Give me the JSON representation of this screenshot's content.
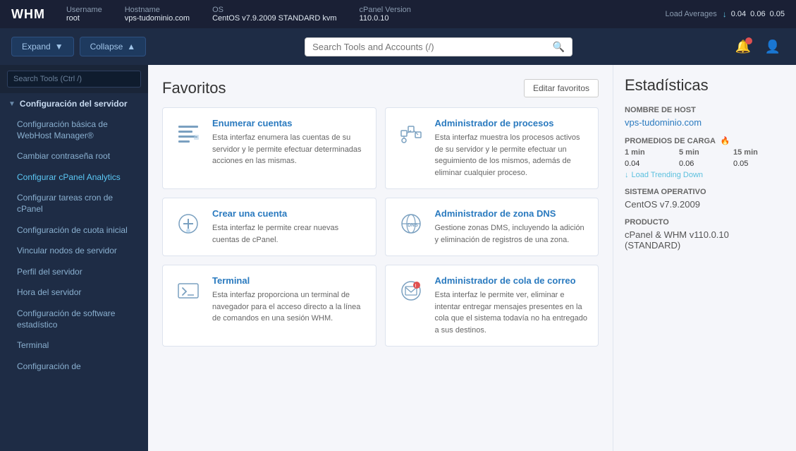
{
  "topbar": {
    "logo": "WHM",
    "username_label": "Username",
    "username": "root",
    "hostname_label": "Hostname",
    "hostname": "vps-tudominio.com",
    "os_label": "OS",
    "os": "CentOS v7.9.2009 STANDARD kvm",
    "cpanel_label": "cPanel Version",
    "cpanel": "110.0.10",
    "load_label": "Load Averages",
    "load_down": "↓",
    "load_1min_label": "0.04",
    "load_5min_label": "0.06",
    "load_15min_label": "0.05"
  },
  "toolbar": {
    "expand_label": "Expand",
    "collapse_label": "Collapse",
    "search_placeholder": "Search Tools and Accounts (/)"
  },
  "sidebar": {
    "search_placeholder": "Search Tools (Ctrl /)",
    "section": "Configuración del servidor",
    "items": [
      "Configuración básica de WebHost Manager®",
      "Cambiar contraseña root",
      "Configurar cPanel Analytics",
      "Configurar tareas cron de cPanel",
      "Configuración de cuota inicial",
      "Vincular nodos de servidor",
      "Perfil del servidor",
      "Hora del servidor",
      "Configuración de software estadístico",
      "Terminal",
      "Configuración de"
    ]
  },
  "favoritos": {
    "title": "Favoritos",
    "edit_btn": "Editar favoritos",
    "cards": [
      {
        "id": "enumerar",
        "title": "Enumerar cuentas",
        "desc": "Esta interfaz enumera las cuentas de su servidor y le permite efectuar determinadas acciones en las mismas.",
        "icon": "list"
      },
      {
        "id": "procesos",
        "title": "Administrador de procesos",
        "desc": "Esta interfaz muestra los procesos activos de su servidor y le permite efectuar un seguimiento de los mismos, además de eliminar cualquier proceso.",
        "icon": "process"
      },
      {
        "id": "crear",
        "title": "Crear una cuenta",
        "desc": "Esta interfaz le permite crear nuevas cuentas de cPanel.",
        "icon": "create"
      },
      {
        "id": "dns",
        "title": "Administrador de zona DNS",
        "desc": "Gestione zonas DMS, incluyendo la adición y eliminación de registros de una zona.",
        "icon": "dns"
      },
      {
        "id": "terminal",
        "title": "Terminal",
        "desc": "Esta interfaz proporciona un terminal de navegador para el acceso directo a la línea de comandos en una sesión WHM.",
        "icon": "terminal"
      },
      {
        "id": "correo",
        "title": "Administrador de cola de correo",
        "desc": "Esta interfaz le permite ver, eliminar e intentar entregar mensajes presentes en la cola que el sistema todavía no ha entregado a sus destinos.",
        "icon": "mail"
      }
    ]
  },
  "estadisticas": {
    "title": "Estadísticas",
    "hostname_label": "Nombre de host",
    "hostname": "vps-tudominio.com",
    "load_label": "Promedios de carga",
    "load_icon": "🔥",
    "load_1min": "1 min",
    "load_5min": "5 min",
    "load_15min": "15 min",
    "load_val1": "0.04",
    "load_val2": "0.06",
    "load_val3": "0.05",
    "load_trending": "↓ Load Trending Down",
    "os_label": "Sistema operativo",
    "os_value": "CentOS v7.9.2009",
    "product_label": "Producto",
    "product_value": "cPanel & WHM v110.0.10 (STANDARD)"
  }
}
